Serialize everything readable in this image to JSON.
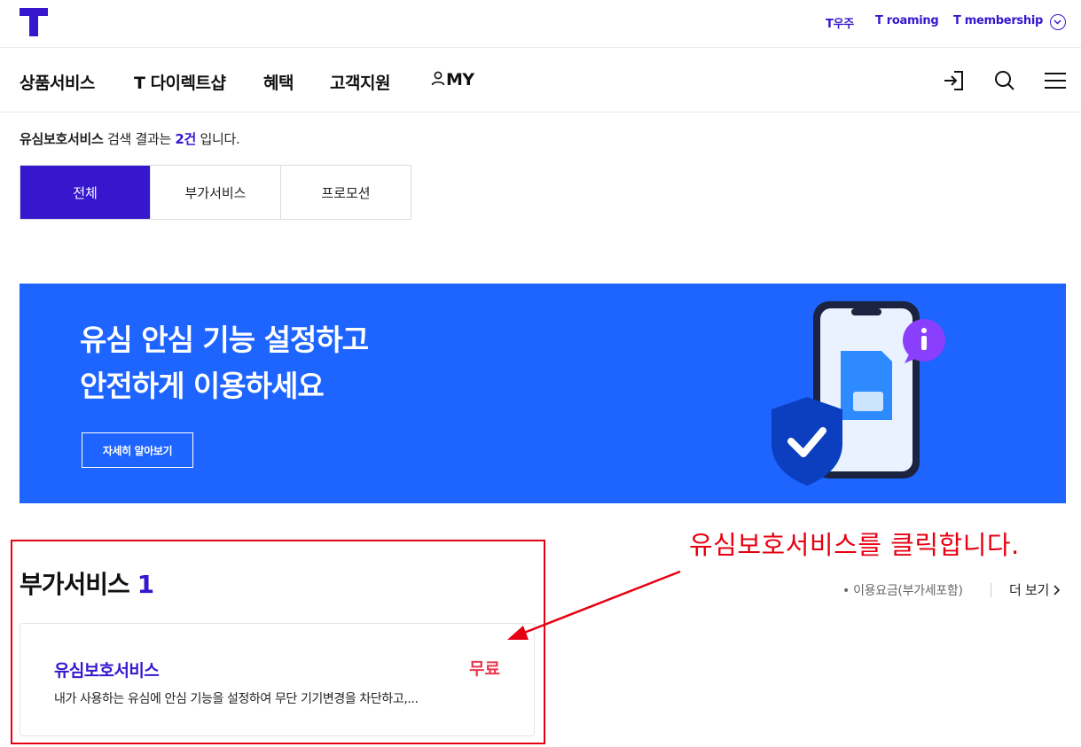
{
  "header": {
    "utility_links": [
      {
        "label": "T우주"
      },
      {
        "label": "T roaming"
      },
      {
        "label": "T membership"
      }
    ]
  },
  "nav": {
    "items": [
      {
        "label": "상품서비스"
      },
      {
        "label": "T 다이렉트샵"
      },
      {
        "label": "혜택"
      },
      {
        "label": "고객지원"
      },
      {
        "label": "MY"
      }
    ]
  },
  "search": {
    "query": "유심보호서비스",
    "text_before_count": "검색 결과는",
    "count": "2건",
    "text_after_count": "입니다."
  },
  "tabs": [
    {
      "label": "전체",
      "active": true
    },
    {
      "label": "부가서비스",
      "active": false
    },
    {
      "label": "프로모션",
      "active": false
    }
  ],
  "banner": {
    "title_line1": "유심 안심 기능 설정하고",
    "title_line2": "안전하게 이용하세요",
    "button_label": "자세히 알아보기"
  },
  "section": {
    "title": "부가서비스",
    "count": "1",
    "note": "• 이용요금(부가세포함)",
    "more_label": "더 보기",
    "items": [
      {
        "name": "유심보호서비스",
        "price": "무료",
        "description": "내가 사용하는 유심에 안심 기능을 설정하여 무단 기기변경을 차단하고,..."
      }
    ]
  },
  "annotation": {
    "instruction": "유심보호서비스를 클릭합니다."
  },
  "colors": {
    "brand": "#3617CE",
    "banner": "#1E64FF",
    "price": "#E8384F",
    "annotation": "#E60012"
  }
}
